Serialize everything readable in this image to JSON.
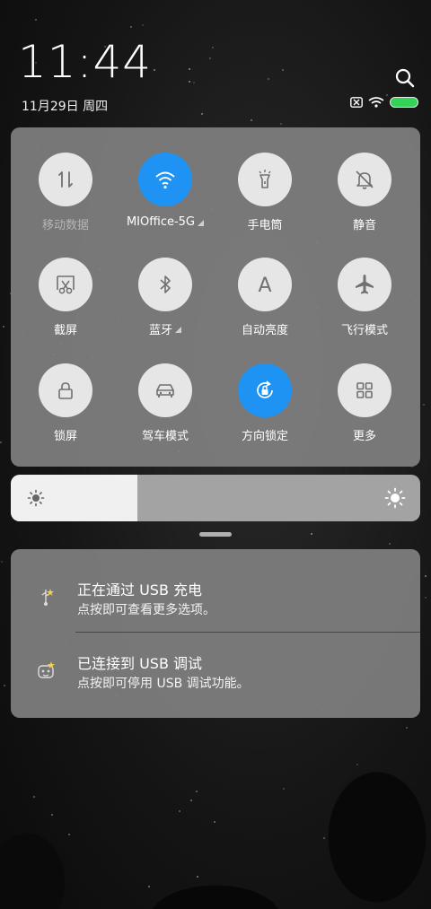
{
  "status": {
    "time": "11:44",
    "date": "11月29日 周四",
    "icons": [
      "sim-absent-icon",
      "wifi-icon",
      "battery-icon"
    ],
    "battery_color": "#33d35a"
  },
  "quick_settings": {
    "tiles": [
      {
        "label": "移动数据",
        "icon": "mobile-data-icon",
        "active": false,
        "dim": true
      },
      {
        "label": "MIOffice-5G",
        "icon": "wifi-icon",
        "active": true,
        "expandable": true
      },
      {
        "label": "手电筒",
        "icon": "flashlight-icon",
        "active": false
      },
      {
        "label": "静音",
        "icon": "mute-bell-icon",
        "active": false
      },
      {
        "label": "截屏",
        "icon": "screenshot-scissors-icon",
        "active": false
      },
      {
        "label": "蓝牙",
        "icon": "bluetooth-icon",
        "active": false,
        "expandable": true
      },
      {
        "label": "自动亮度",
        "icon": "auto-brightness-icon",
        "active": false
      },
      {
        "label": "飞行模式",
        "icon": "airplane-icon",
        "active": false
      },
      {
        "label": "锁屏",
        "icon": "lock-icon",
        "active": false
      },
      {
        "label": "驾车模式",
        "icon": "car-icon",
        "active": false
      },
      {
        "label": "方向锁定",
        "icon": "rotation-lock-icon",
        "active": true
      },
      {
        "label": "更多",
        "icon": "grid-icon",
        "active": false
      }
    ],
    "active_color": "#1e93f3"
  },
  "brightness": {
    "level": 0.31
  },
  "notifications": [
    {
      "title": "正在通过 USB 充电",
      "subtitle": "点按即可查看更多选项。",
      "icon": "usb-charging-icon"
    },
    {
      "title": "已连接到 USB 调试",
      "subtitle": "点按即可停用 USB 调试功能。",
      "icon": "usb-debug-icon"
    }
  ]
}
